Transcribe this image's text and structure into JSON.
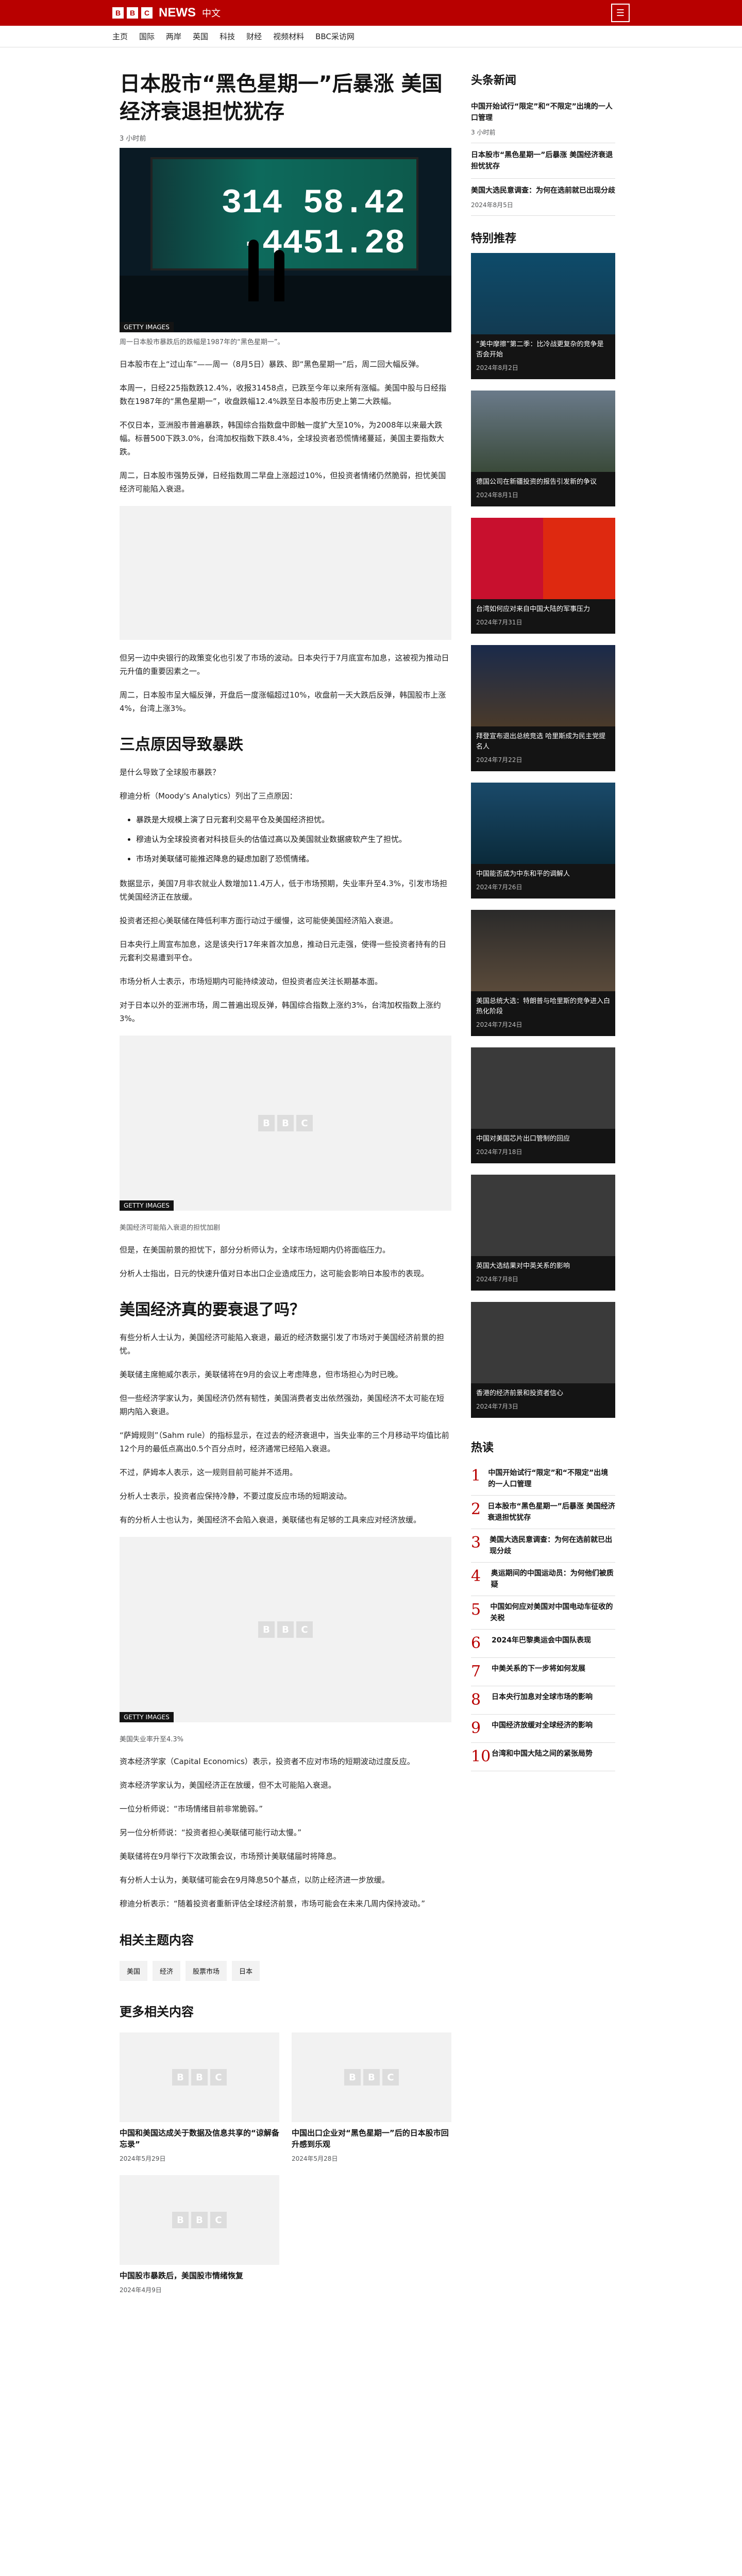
{
  "brand": {
    "logo": "BBC",
    "name": "NEWS",
    "sub": "中文",
    "menu": "☰"
  },
  "nav": [
    "主页",
    "国际",
    "两岸",
    "英国",
    "科技",
    "财经",
    "视频材料",
    "BBC采访网"
  ],
  "article": {
    "title": "日本股市“黑色星期一”后暴涨 美国经济衰退担忧犹存",
    "byline": "3 小时前",
    "hero_tag": "GETTY IMAGES",
    "hero_numbers": [
      "314 58.42",
      "-4451.28"
    ],
    "hero_caption": "周一日本股市暴跌后的跌幅是1987年的“黑色星期一”。",
    "p1": "日本股市在上“过山车”——周一（8月5日）暴跌、即“黑色星期一”后，周二回大幅反弹。",
    "p2": "本周一，日经225指数跌12.4%，收报31458点，已跌至今年以来所有涨幅。美国中股与日经指数在1987年的“黑色星期一”，收盘跌幅12.4%跌至日本股市历史上第二大跌幅。",
    "p3": "不仅日本，亚洲股市普遍暴跌，韩国综合指数盘中即触一度扩大至10%，为2008年以来最大跌幅。标普500下跌3.0%，台湾加权指数下跌8.4%，全球投资者恐慌情绪蔓延，美国主要指数大跌。",
    "p4": "周二，日本股市强势反弹，日经指数周二早盘上涨超过10%，但投资者情绪仍然脆弱，担忧美国经济可能陷入衰退。",
    "p5": "但另一边中央银行的政策变化也引发了市场的波动。日本央行于7月底宣布加息，这被视为推动日元升值的重要因素之一。",
    "p6": "周二，日本股市呈大幅反弹，开盘后一度涨幅超过10%，收盘前一天大跌后反弹，韩国股市上涨4%，台湾上涨3%。",
    "h2a": "三点原因导致暴跌",
    "q": "是什么导致了全球股市暴跌？",
    "q2": "穆迪分析（Moody's Analytics）列出了三点原因：",
    "bullets": [
      "暴跌是大规模上演了日元套利交易平仓及美国经济担忧。",
      "穆迪认为全球投资者对科技巨头的估值过高以及美国就业数据疲软产生了担忧。",
      "市场对美联储可能推迟降息的疑虑加剧了恐慌情绪。"
    ],
    "p7": "数据显示，美国7月非农就业人数增加11.4万人，低于市场预期，失业率升至4.3%，引发市场担忧美国经济正在放缓。",
    "p8": "投资者还担心美联储在降低利率方面行动过于缓慢，这可能使美国经济陷入衰退。",
    "p9": "日本央行上周宣布加息，这是该央行17年来首次加息，推动日元走强，使得一些投资者持有的日元套利交易遭到平仓。",
    "p10": "市场分析人士表示，市场短期内可能持续波动，但投资者应关注长期基本面。",
    "p11": "对于日本以外的亚洲市场，周二普遍出现反弹，韩国综合指数上涨约3%，台湾加权指数上涨约3%。",
    "ph_tag": "GETTY IMAGES",
    "ph_caption": "美国经济可能陷入衰退的担忧加剧",
    "p12": "但是，在美国前景的担忧下，部分分析师认为，全球市场短期内仍将面临压力。",
    "p13": "分析人士指出，日元的快速升值对日本出口企业造成压力，这可能会影响日本股市的表现。",
    "h2b": "美国经济真的要衰退了吗？",
    "p14": "有些分析人士认为，美国经济可能陷入衰退，最近的经济数据引发了市场对于美国经济前景的担忧。",
    "p15": "美联储主席鲍威尔表示，美联储将在9月的会议上考虑降息，但市场担心为时已晚。",
    "p16": "但一些经济学家认为，美国经济仍然有韧性，美国消费者支出依然强劲，美国经济不太可能在短期内陷入衰退。",
    "p17": "“萨姆规则”（Sahm rule）的指标显示，在过去的经济衰退中，当失业率的三个月移动平均值比前12个月的最低点高出0.5个百分点时，经济通常已经陷入衰退。",
    "p18": "不过，萨姆本人表示，这一规则目前可能并不适用。",
    "p19": "分析人士表示，投资者应保持冷静，不要过度反应市场的短期波动。",
    "p20": "有的分析人士也认为，美国经济不会陷入衰退，美联储也有足够的工具来应对经济放缓。",
    "ph2_tag": "GETTY IMAGES",
    "ph2_caption": "美国失业率升至4.3%",
    "p21": "资本经济学家（Capital Economics）表示，投资者不应对市场的短期波动过度反应。",
    "p22": "资本经济学家认为，美国经济正在放缓，但不太可能陷入衰退。",
    "p23": "一位分析师说：“市场情绪目前非常脆弱。”",
    "p24": "另一位分析师说：“投资者担心美联储可能行动太慢。”",
    "p25": "美联储将在9月举行下次政策会议，市场预计美联储届时将降息。",
    "p26": "有分析人士认为，美联储可能会在9月降息50个基点，以防止经济进一步放缓。",
    "p27": "穆迪分析表示：“随着投资者重新评估全球经济前景，市场可能会在未来几周内保持波动。”",
    "topics_title": "相关主题内容",
    "topics": [
      "美国",
      "经济",
      "股票市场",
      "日本"
    ],
    "more_title": "更多相关内容",
    "more": [
      {
        "t": "中国和美国达成关于数据及信息共享的“谅解备忘录”",
        "d": "2024年5月29日"
      },
      {
        "t": "中国出口企业对“黑色星期一”后的日本股市回升感到乐观",
        "d": "2024年5月28日"
      },
      {
        "t": "中国股市暴跌后，美国股市情绪恢复",
        "d": "2024年4月9日"
      }
    ]
  },
  "side": {
    "headline_title": "头条新闻",
    "headlines": [
      {
        "t": "中国开始试行“限定”和“不限定”出境的一人口管理",
        "d": "3 小时前"
      },
      {
        "t": "日本股市“黑色星期一”后暴涨 美国经济衰退担忧犹存",
        "d": ""
      },
      {
        "t": "美国大选民意调查：为何在选前就已出现分歧",
        "d": "2024年8月5日"
      }
    ],
    "feat_title": "特别推荐",
    "feat": [
      {
        "t": "“美中摩擦”第二季：比冷战更复杂的竞争是否会开始",
        "d": "2024年8月2日"
      },
      {
        "t": "德国公司在新疆投资的报告引发新的争议",
        "d": "2024年8月1日"
      },
      {
        "t": "台湾如何应对来自中国大陆的军事压力",
        "d": "2024年7月31日"
      },
      {
        "t": "拜登宣布退出总统竞选 哈里斯成为民主党提名人",
        "d": "2024年7月22日"
      },
      {
        "t": "中国能否成为中东和平的调解人",
        "d": "2024年7月26日"
      },
      {
        "t": "美国总统大选：特朗普与哈里斯的竞争进入白热化阶段",
        "d": "2024年7月24日"
      },
      {
        "t": "中国对美国芯片出口管制的回应",
        "d": "2024年7月18日"
      },
      {
        "t": "英国大选结果对中英关系的影响",
        "d": "2024年7月8日"
      },
      {
        "t": "香港的经济前景和投资者信心",
        "d": "2024年7月3日"
      }
    ],
    "pop_title": "热读",
    "popular": [
      "中国开始试行“限定”和“不限定”出境的一人口管理",
      "日本股市“黑色星期一”后暴涨 美国经济衰退担忧犹存",
      "美国大选民意调查：为何在选前就已出现分歧",
      "奥运期间的中国运动员：为何他们被质疑",
      "中国如何应对美国对中国电动车征收的关税",
      "2024年巴黎奥运会中国队表现",
      "中美关系的下一步将如何发展",
      "日本央行加息对全球市场的影响",
      "中国经济放缓对全球经济的影响",
      "台湾和中国大陆之间的紧张局势"
    ]
  }
}
